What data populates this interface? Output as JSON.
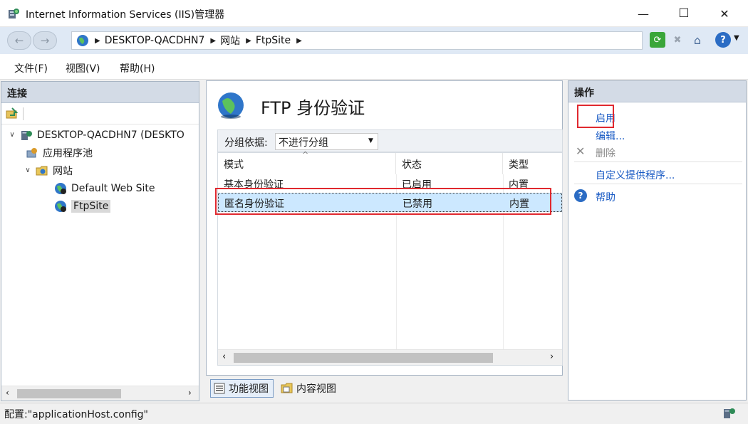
{
  "window": {
    "title": "Internet Information Services (IIS)管理器",
    "minimize": "—",
    "maximize": "☐",
    "close": "✕"
  },
  "address": {
    "crumbs": [
      "DESKTOP-QACDHN7",
      "网站",
      "FtpSite"
    ]
  },
  "menu": [
    "文件(F)",
    "视图(V)",
    "帮助(H)"
  ],
  "connections": {
    "header": "连接",
    "server": "DESKTOP-QACDHN7 (DESKTO",
    "app_pools": "应用程序池",
    "sites": "网站",
    "default_site": "Default Web Site",
    "ftp_site": "FtpSite"
  },
  "main": {
    "title": "FTP 身份验证",
    "group_label": "分组依据:",
    "group_value": "不进行分组",
    "columns": [
      "模式",
      "状态",
      "类型"
    ],
    "rows": [
      {
        "mode": "基本身份验证",
        "status": "已启用",
        "type": "内置"
      },
      {
        "mode": "匿名身份验证",
        "status": "已禁用",
        "type": "内置"
      }
    ],
    "selected_row": 1
  },
  "views": {
    "features": "功能视图",
    "content": "内容视图"
  },
  "actions": {
    "header": "操作",
    "enable": "启用",
    "edit": "编辑...",
    "delete": "删除",
    "custom_providers": "自定义提供程序...",
    "help": "帮助"
  },
  "status": {
    "text": "配置:\"applicationHost.config\""
  },
  "colors": {
    "accent": "#1a5bc4",
    "selection": "#cce8ff",
    "highlight_box": "#e0292f",
    "panel_header": "#d3dbe6"
  }
}
